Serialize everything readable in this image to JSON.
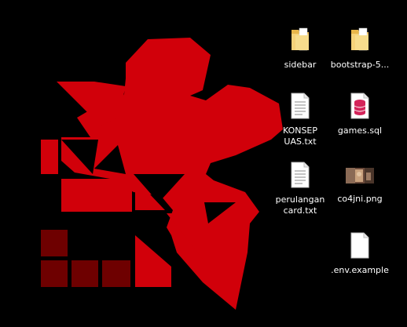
{
  "desktop": {
    "wallpaper": {
      "description_name": "nerv-logo",
      "colors": {
        "background": "#000000",
        "primary_red": "#d1000a",
        "dark_red": "#6e0000"
      }
    },
    "icons": [
      {
        "label": "sidebar",
        "type": "folder-icon"
      },
      {
        "label": "bootstrap-5...",
        "type": "folder-icon"
      },
      {
        "label": "KONSEP UAS.txt",
        "type": "text-file-icon"
      },
      {
        "label": "games.sql",
        "type": "database-file-icon"
      },
      {
        "label": "perulangan card.txt",
        "type": "text-file-icon"
      },
      {
        "label": "co4jni.png",
        "type": "image-thumbnail-icon"
      },
      {
        "label": ".env.example",
        "type": "blank-file-icon"
      }
    ]
  }
}
